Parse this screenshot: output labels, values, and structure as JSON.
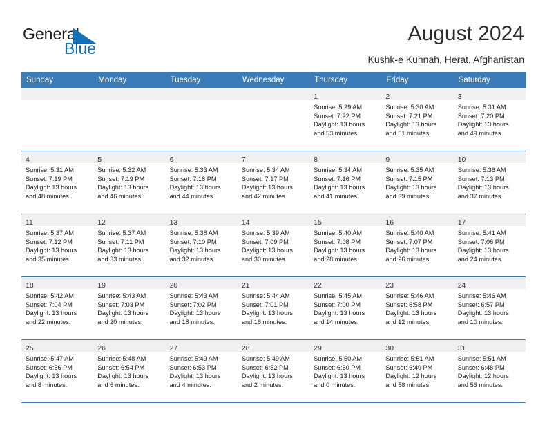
{
  "brand": {
    "name_part1": "General",
    "name_part2": "Blue",
    "flag_icon": "flag-triangle-icon",
    "accent_color": "#1272b8"
  },
  "header": {
    "title": "August 2024",
    "subtitle": "Kushk-e Kuhnah, Herat, Afghanistan"
  },
  "theme": {
    "header_row_bg": "#3b7cb8",
    "day_band_bg": "#f0f0f0",
    "grid_line": "#3b7cb8"
  },
  "weekdays": [
    "Sunday",
    "Monday",
    "Tuesday",
    "Wednesday",
    "Thursday",
    "Friday",
    "Saturday"
  ],
  "weeks": [
    [
      {
        "date": "",
        "sunrise": "",
        "sunset": "",
        "daylight_1": "",
        "daylight_2": ""
      },
      {
        "date": "",
        "sunrise": "",
        "sunset": "",
        "daylight_1": "",
        "daylight_2": ""
      },
      {
        "date": "",
        "sunrise": "",
        "sunset": "",
        "daylight_1": "",
        "daylight_2": ""
      },
      {
        "date": "",
        "sunrise": "",
        "sunset": "",
        "daylight_1": "",
        "daylight_2": ""
      },
      {
        "date": "1",
        "sunrise": "Sunrise: 5:29 AM",
        "sunset": "Sunset: 7:22 PM",
        "daylight_1": "Daylight: 13 hours",
        "daylight_2": "and 53 minutes."
      },
      {
        "date": "2",
        "sunrise": "Sunrise: 5:30 AM",
        "sunset": "Sunset: 7:21 PM",
        "daylight_1": "Daylight: 13 hours",
        "daylight_2": "and 51 minutes."
      },
      {
        "date": "3",
        "sunrise": "Sunrise: 5:31 AM",
        "sunset": "Sunset: 7:20 PM",
        "daylight_1": "Daylight: 13 hours",
        "daylight_2": "and 49 minutes."
      }
    ],
    [
      {
        "date": "4",
        "sunrise": "Sunrise: 5:31 AM",
        "sunset": "Sunset: 7:19 PM",
        "daylight_1": "Daylight: 13 hours",
        "daylight_2": "and 48 minutes."
      },
      {
        "date": "5",
        "sunrise": "Sunrise: 5:32 AM",
        "sunset": "Sunset: 7:19 PM",
        "daylight_1": "Daylight: 13 hours",
        "daylight_2": "and 46 minutes."
      },
      {
        "date": "6",
        "sunrise": "Sunrise: 5:33 AM",
        "sunset": "Sunset: 7:18 PM",
        "daylight_1": "Daylight: 13 hours",
        "daylight_2": "and 44 minutes."
      },
      {
        "date": "7",
        "sunrise": "Sunrise: 5:34 AM",
        "sunset": "Sunset: 7:17 PM",
        "daylight_1": "Daylight: 13 hours",
        "daylight_2": "and 42 minutes."
      },
      {
        "date": "8",
        "sunrise": "Sunrise: 5:34 AM",
        "sunset": "Sunset: 7:16 PM",
        "daylight_1": "Daylight: 13 hours",
        "daylight_2": "and 41 minutes."
      },
      {
        "date": "9",
        "sunrise": "Sunrise: 5:35 AM",
        "sunset": "Sunset: 7:15 PM",
        "daylight_1": "Daylight: 13 hours",
        "daylight_2": "and 39 minutes."
      },
      {
        "date": "10",
        "sunrise": "Sunrise: 5:36 AM",
        "sunset": "Sunset: 7:13 PM",
        "daylight_1": "Daylight: 13 hours",
        "daylight_2": "and 37 minutes."
      }
    ],
    [
      {
        "date": "11",
        "sunrise": "Sunrise: 5:37 AM",
        "sunset": "Sunset: 7:12 PM",
        "daylight_1": "Daylight: 13 hours",
        "daylight_2": "and 35 minutes."
      },
      {
        "date": "12",
        "sunrise": "Sunrise: 5:37 AM",
        "sunset": "Sunset: 7:11 PM",
        "daylight_1": "Daylight: 13 hours",
        "daylight_2": "and 33 minutes."
      },
      {
        "date": "13",
        "sunrise": "Sunrise: 5:38 AM",
        "sunset": "Sunset: 7:10 PM",
        "daylight_1": "Daylight: 13 hours",
        "daylight_2": "and 32 minutes."
      },
      {
        "date": "14",
        "sunrise": "Sunrise: 5:39 AM",
        "sunset": "Sunset: 7:09 PM",
        "daylight_1": "Daylight: 13 hours",
        "daylight_2": "and 30 minutes."
      },
      {
        "date": "15",
        "sunrise": "Sunrise: 5:40 AM",
        "sunset": "Sunset: 7:08 PM",
        "daylight_1": "Daylight: 13 hours",
        "daylight_2": "and 28 minutes."
      },
      {
        "date": "16",
        "sunrise": "Sunrise: 5:40 AM",
        "sunset": "Sunset: 7:07 PM",
        "daylight_1": "Daylight: 13 hours",
        "daylight_2": "and 26 minutes."
      },
      {
        "date": "17",
        "sunrise": "Sunrise: 5:41 AM",
        "sunset": "Sunset: 7:06 PM",
        "daylight_1": "Daylight: 13 hours",
        "daylight_2": "and 24 minutes."
      }
    ],
    [
      {
        "date": "18",
        "sunrise": "Sunrise: 5:42 AM",
        "sunset": "Sunset: 7:04 PM",
        "daylight_1": "Daylight: 13 hours",
        "daylight_2": "and 22 minutes."
      },
      {
        "date": "19",
        "sunrise": "Sunrise: 5:43 AM",
        "sunset": "Sunset: 7:03 PM",
        "daylight_1": "Daylight: 13 hours",
        "daylight_2": "and 20 minutes."
      },
      {
        "date": "20",
        "sunrise": "Sunrise: 5:43 AM",
        "sunset": "Sunset: 7:02 PM",
        "daylight_1": "Daylight: 13 hours",
        "daylight_2": "and 18 minutes."
      },
      {
        "date": "21",
        "sunrise": "Sunrise: 5:44 AM",
        "sunset": "Sunset: 7:01 PM",
        "daylight_1": "Daylight: 13 hours",
        "daylight_2": "and 16 minutes."
      },
      {
        "date": "22",
        "sunrise": "Sunrise: 5:45 AM",
        "sunset": "Sunset: 7:00 PM",
        "daylight_1": "Daylight: 13 hours",
        "daylight_2": "and 14 minutes."
      },
      {
        "date": "23",
        "sunrise": "Sunrise: 5:46 AM",
        "sunset": "Sunset: 6:58 PM",
        "daylight_1": "Daylight: 13 hours",
        "daylight_2": "and 12 minutes."
      },
      {
        "date": "24",
        "sunrise": "Sunrise: 5:46 AM",
        "sunset": "Sunset: 6:57 PM",
        "daylight_1": "Daylight: 13 hours",
        "daylight_2": "and 10 minutes."
      }
    ],
    [
      {
        "date": "25",
        "sunrise": "Sunrise: 5:47 AM",
        "sunset": "Sunset: 6:56 PM",
        "daylight_1": "Daylight: 13 hours",
        "daylight_2": "and 8 minutes."
      },
      {
        "date": "26",
        "sunrise": "Sunrise: 5:48 AM",
        "sunset": "Sunset: 6:54 PM",
        "daylight_1": "Daylight: 13 hours",
        "daylight_2": "and 6 minutes."
      },
      {
        "date": "27",
        "sunrise": "Sunrise: 5:49 AM",
        "sunset": "Sunset: 6:53 PM",
        "daylight_1": "Daylight: 13 hours",
        "daylight_2": "and 4 minutes."
      },
      {
        "date": "28",
        "sunrise": "Sunrise: 5:49 AM",
        "sunset": "Sunset: 6:52 PM",
        "daylight_1": "Daylight: 13 hours",
        "daylight_2": "and 2 minutes."
      },
      {
        "date": "29",
        "sunrise": "Sunrise: 5:50 AM",
        "sunset": "Sunset: 6:50 PM",
        "daylight_1": "Daylight: 13 hours",
        "daylight_2": "and 0 minutes."
      },
      {
        "date": "30",
        "sunrise": "Sunrise: 5:51 AM",
        "sunset": "Sunset: 6:49 PM",
        "daylight_1": "Daylight: 12 hours",
        "daylight_2": "and 58 minutes."
      },
      {
        "date": "31",
        "sunrise": "Sunrise: 5:51 AM",
        "sunset": "Sunset: 6:48 PM",
        "daylight_1": "Daylight: 12 hours",
        "daylight_2": "and 56 minutes."
      }
    ]
  ]
}
